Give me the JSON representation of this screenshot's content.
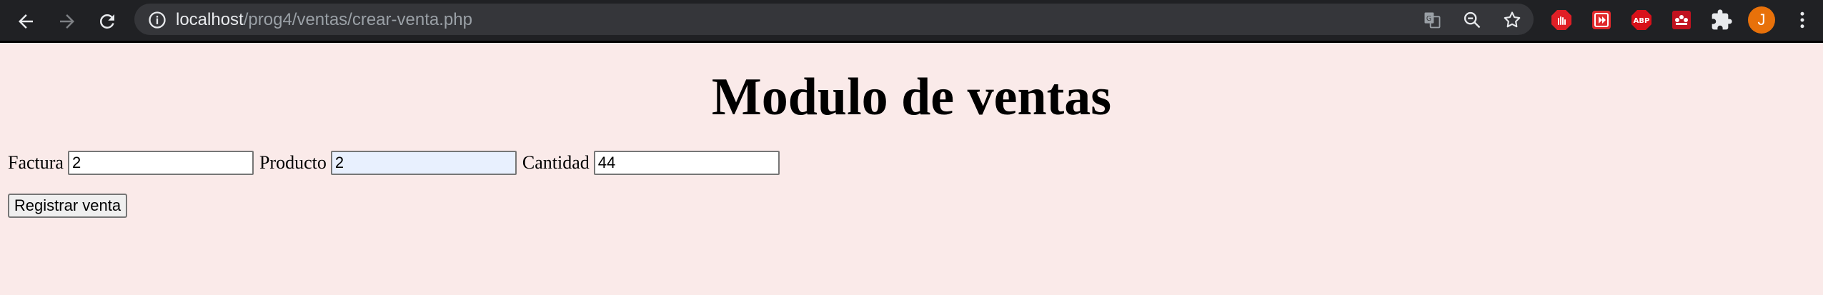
{
  "browser": {
    "url_host": "localhost",
    "url_path": "/prog4/ventas/crear-venta.php",
    "profile_initial": "J",
    "extensions": [
      "adblock-icon",
      "shortcut-icon",
      "abp-icon",
      "mendeley-icon"
    ],
    "abp_label": "ABP"
  },
  "page": {
    "title": "Modulo de ventas",
    "form": {
      "factura": {
        "label": "Factura",
        "value": "2"
      },
      "producto": {
        "label": "Producto",
        "value": "2"
      },
      "cantidad": {
        "label": "Cantidad",
        "value": "44"
      },
      "submit_label": "Registrar venta"
    }
  },
  "colors": {
    "chrome": "#202124",
    "omnibox": "#35363a",
    "page_background": "#faeae9",
    "autofill": "#e8f0fe",
    "avatar": "#e8710a"
  }
}
